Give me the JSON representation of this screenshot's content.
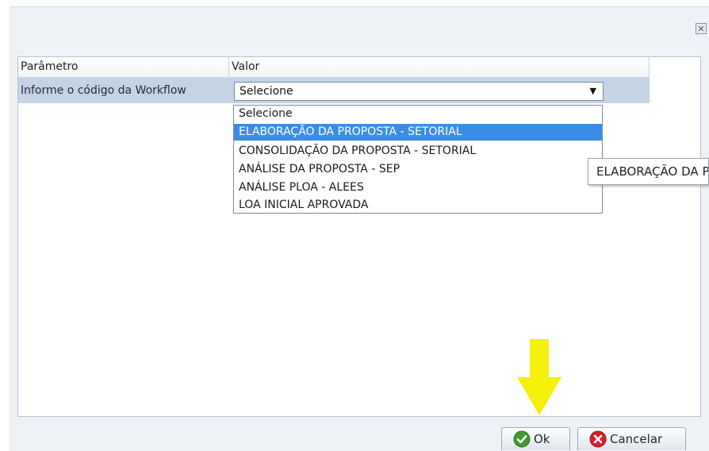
{
  "dialog": {
    "close_icon": "close-icon",
    "grid": {
      "headers": {
        "param": "Parâmetro",
        "valor": "Valor"
      },
      "row": {
        "label": "Informe o código da Workflow",
        "selected_value": "Selecione"
      }
    },
    "dropdown": {
      "options": [
        "Selecione",
        "ELABORAÇÃO DA PROPOSTA - SETORIAL",
        "CONSOLIDAÇÃO DA PROPOSTA - SETORIAL",
        "ANÁLISE DA PROPOSTA - SEP",
        "ANÁLISE PLOA - ALEES",
        "LOA INICIAL APROVADA"
      ],
      "highlighted_index": 1
    },
    "tooltip": "ELABORAÇÃO DA PROPOSTA - SETORIAL",
    "buttons": {
      "ok": "Ok",
      "cancel": "Cancelar"
    }
  },
  "colors": {
    "highlight": "#3b8de4",
    "row_bg": "#c5d3e6",
    "arrow": "#f5ef0a"
  }
}
